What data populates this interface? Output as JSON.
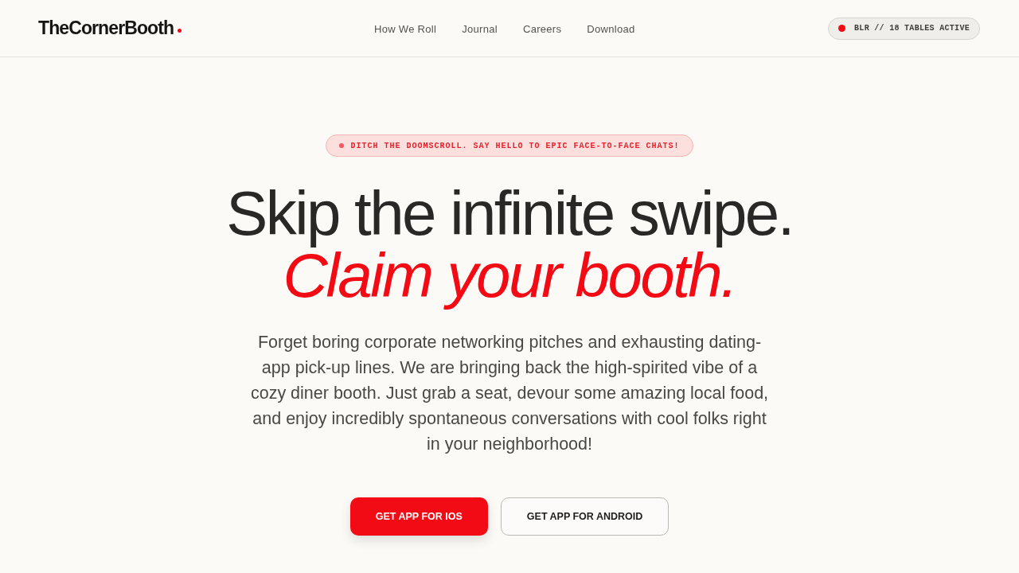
{
  "header": {
    "logo": "TheCornerBooth",
    "nav": [
      "How We Roll",
      "Journal",
      "Careers",
      "Download"
    ],
    "status": "BLR // 18 TABLES ACTIVE"
  },
  "hero": {
    "badge": "DITCH THE DOOMSCROLL. SAY HELLO TO EPIC FACE-TO-FACE CHATS!",
    "headline": [
      {
        "text": "Skip the infinite swipe.",
        "kind": "plain"
      },
      {
        "text": "Claim your booth.",
        "kind": "accent"
      }
    ],
    "description": "Forget boring corporate networking pitches and exhausting dating-app pick-up lines. We are bringing back the high-spirited vibe of a cozy diner booth. Just grab a seat, devour some amazing local food, and enjoy incredibly spontaneous conversations with cool folks right in your neighborhood!",
    "buttons": [
      {
        "label": "GET APP FOR IOS",
        "kind": "primary"
      },
      {
        "label": "GET APP FOR ANDROID",
        "kind": "secondary"
      }
    ]
  }
}
